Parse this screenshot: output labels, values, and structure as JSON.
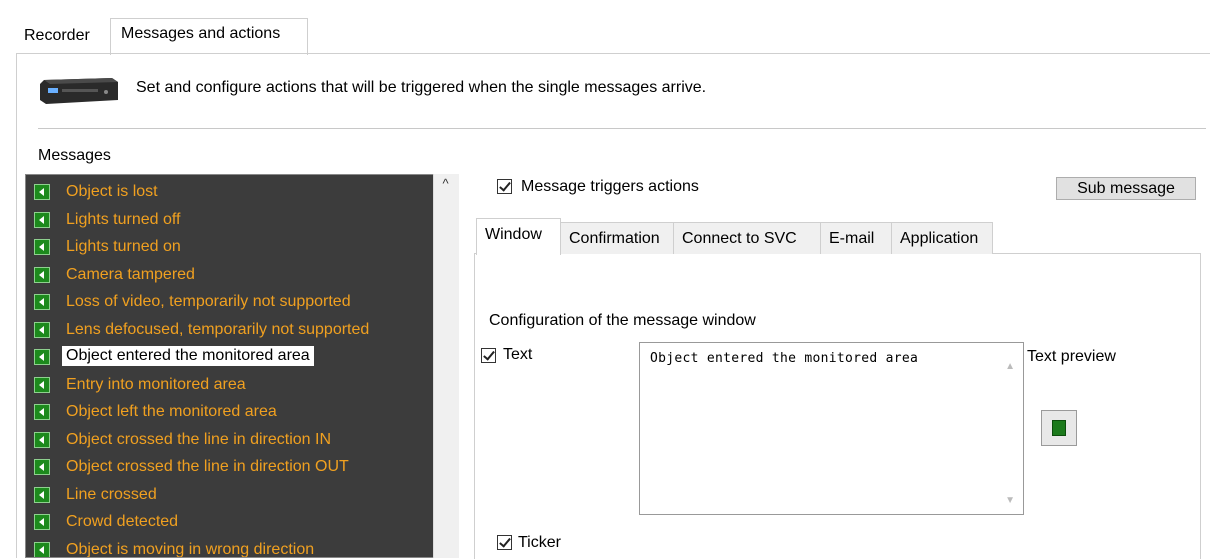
{
  "top_tabs": [
    {
      "label": "Recorder",
      "active": false
    },
    {
      "label": "Messages and actions",
      "active": true
    }
  ],
  "header": {
    "icon": "dvr-device-icon",
    "description": "Set and configure actions that will be triggered when the single messages arrive."
  },
  "messages": {
    "title": "Messages",
    "items": [
      {
        "label": "Object is lost"
      },
      {
        "label": "Lights turned off"
      },
      {
        "label": "Lights turned on"
      },
      {
        "label": "Camera tampered"
      },
      {
        "label": "Loss of video, temporarily not supported"
      },
      {
        "label": "Lens defocused, temporarily not supported"
      },
      {
        "label": "Object entered the monitored area",
        "selected": true
      },
      {
        "label": "Entry into monitored area"
      },
      {
        "label": "Object left the monitored area"
      },
      {
        "label": "Object crossed the line in direction IN"
      },
      {
        "label": "Object crossed the line in direction OUT"
      },
      {
        "label": "Line crossed"
      },
      {
        "label": "Crowd detected"
      },
      {
        "label": "Object is moving in wrong direction"
      }
    ]
  },
  "actions": {
    "triggers_label": "Message triggers actions",
    "triggers_checked": true,
    "sub_message_button": "Sub message",
    "tabs": [
      "Window",
      "Confirmation",
      "Connect to SVC",
      "E-mail",
      "Application"
    ],
    "active_tab": "Window",
    "window": {
      "config_label": "Configuration of the message window",
      "text_label": "Text",
      "text_checked": true,
      "text_value": "Object entered the monitored area",
      "preview_label": "Text preview",
      "ticker_label": "Ticker",
      "ticker_checked": true
    }
  },
  "colors": {
    "list_background": "#3c3c3c",
    "list_text": "#f0a020",
    "icon_green": "#1d8a1d"
  }
}
